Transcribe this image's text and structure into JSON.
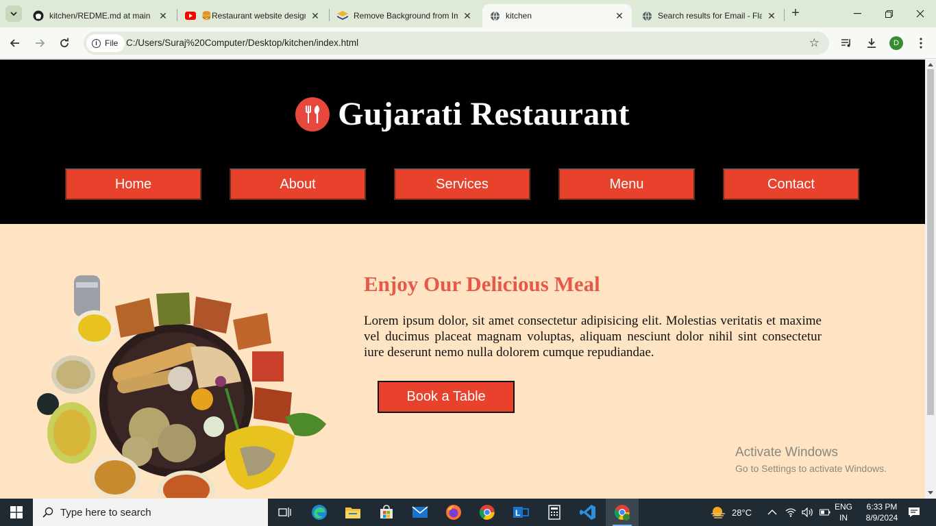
{
  "browser": {
    "tabs": [
      {
        "title": "kitchen/REDME.md at main",
        "icon": "github-icon"
      },
      {
        "title": "🍔Restaurant website design",
        "icon": "youtube-icon"
      },
      {
        "title": "Remove Background from Image",
        "icon": "removebg-icon"
      },
      {
        "title": "kitchen",
        "icon": "globe-icon",
        "active": true
      },
      {
        "title": "Search results for Email - Flaticon",
        "icon": "globe-icon"
      }
    ],
    "omnibox": {
      "chip_label": "File",
      "url": "C:/Users/Suraj%20Computer/Desktop/kitchen/index.html"
    },
    "profile_initial": "D"
  },
  "page": {
    "brand_name": "Gujarati Restaurant",
    "nav": [
      "Home",
      "About",
      "Services",
      "Menu",
      "Contact"
    ],
    "hero": {
      "title": "Enjoy Our Delicious Meal",
      "text": "Lorem ipsum dolor, sit amet consectetur adipisicing elit. Molestias veritatis et maxime vel ducimus placeat magnam voluptas, aliquam nesciunt dolor nihil sint consectetur iure deserunt nemo nulla dolorem cumque repudiandae.",
      "button": "Book a Table"
    },
    "colors": {
      "accent": "#e8412c",
      "title": "#e8584a",
      "background": "#ffe4c4",
      "header": "#000000"
    }
  },
  "watermark": {
    "line1": "Activate Windows",
    "line2": "Go to Settings to activate Windows."
  },
  "taskbar": {
    "search_placeholder": "Type here to search",
    "weather": "28°C",
    "lang_top": "ENG",
    "lang_bottom": "IN",
    "time": "6:33 PM",
    "date": "8/9/2024"
  }
}
